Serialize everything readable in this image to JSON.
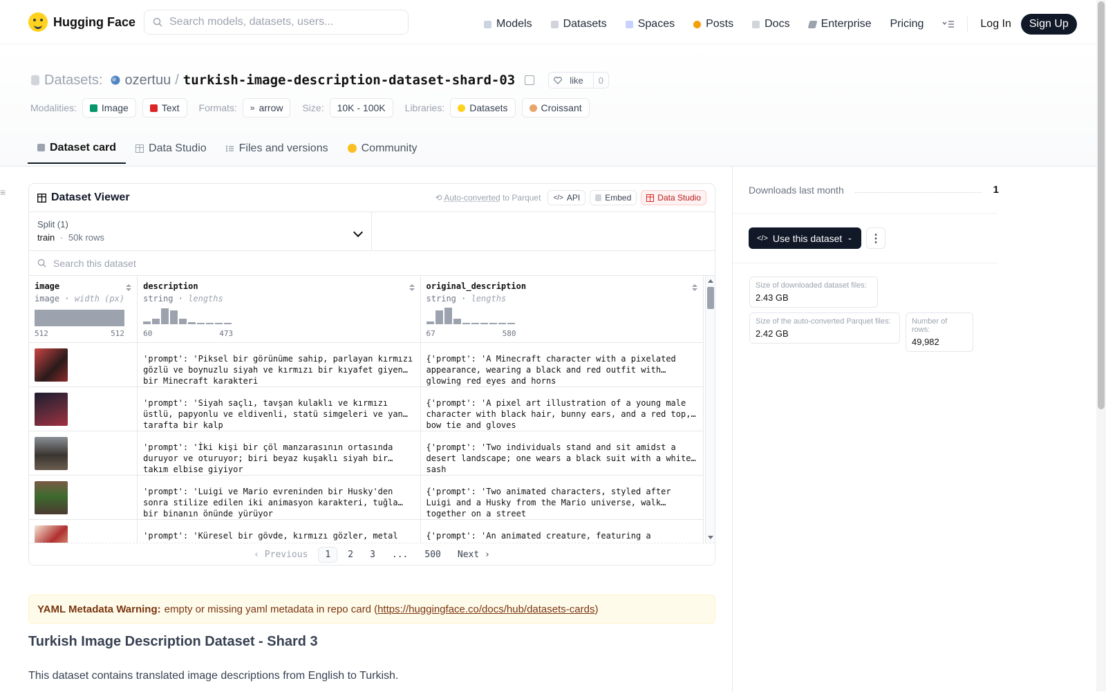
{
  "nav": {
    "brand": "Hugging Face",
    "search_placeholder": "Search models, datasets, users...",
    "links": [
      "Models",
      "Datasets",
      "Spaces",
      "Posts",
      "Docs",
      "Enterprise",
      "Pricing"
    ],
    "login": "Log In",
    "signup": "Sign Up"
  },
  "header": {
    "section_label": "Datasets:",
    "owner": "ozertuu",
    "separator": "/",
    "repo": "turkish-image-description-dataset-shard-03",
    "like_label": "like",
    "like_count": "0",
    "modalities_label": "Modalities:",
    "modalities": [
      "Image",
      "Text"
    ],
    "formats_label": "Formats:",
    "format": "arrow",
    "size_label": "Size:",
    "size": "10K - 100K",
    "libraries_label": "Libraries:",
    "libraries": [
      "Datasets",
      "Croissant"
    ]
  },
  "tabs": [
    "Dataset card",
    "Data Studio",
    "Files and versions",
    "Community"
  ],
  "viewer": {
    "title": "Dataset Viewer",
    "auto_converted": "Auto-converted",
    "to_parquet": "to Parquet",
    "api": "API",
    "embed": "Embed",
    "data_studio": "Data Studio",
    "split_label": "Split (1)",
    "split_name": "train",
    "split_dot": "·",
    "split_rows": "50k rows",
    "search_placeholder": "Search this dataset",
    "columns": [
      {
        "name": "image",
        "type": "image",
        "stat": "width (px)",
        "min": "512",
        "max": "512"
      },
      {
        "name": "description",
        "type": "string",
        "stat": "lengths",
        "min": "60",
        "max": "473"
      },
      {
        "name": "original_description",
        "type": "string",
        "stat": "lengths",
        "min": "67",
        "max": "580"
      }
    ],
    "histograms": {
      "description": [
        0.15,
        0.35,
        0.95,
        0.85,
        0.35,
        0.12,
        0.05,
        0.05,
        0.05,
        0.05
      ],
      "original_description": [
        0.15,
        0.85,
        1.0,
        0.35,
        0.1,
        0.05,
        0.05,
        0.05,
        0.05,
        0.05
      ]
    },
    "rows": [
      {
        "thumb_color": "#8b2a2a",
        "description": "'prompt': 'Piksel bir görünüme sahip, parlayan kırmızı gözlü ve boynuzlu siyah ve kırmızı bir kıyafet giyen bir Minecraft karakteri",
        "original": "{'prompt': 'A Minecraft character with a pixelated appearance, wearing a black and red outfit with glowing red eyes and horns"
      },
      {
        "thumb_color": "#3a2440",
        "description": "'prompt': 'Siyah saçlı, tavşan kulaklı ve kırmızı üstlü, papyonlu ve eldivenli, statü simgeleri ve yan tarafta bir kalp",
        "original": "{'prompt': 'A pixel art illustration of a young male character with black hair, bunny ears, and a red top, bow tie and gloves"
      },
      {
        "thumb_color": "#5b544b",
        "description": "'prompt': 'İki kişi bir çöl manzarasının ortasında duruyor ve oturuyor; biri beyaz kuşaklı siyah bir takım elbise giyiyor",
        "original": "{'prompt': 'Two individuals stand and sit amidst a desert landscape; one wears a black suit with a white sash"
      },
      {
        "thumb_color": "#6b4a3a",
        "description": "'prompt': 'Luigi ve Mario evreninden bir Husky'den sonra stilize edilen iki animasyon karakteri, tuğla bir binanın önünde yürüyor",
        "original": "{'prompt': 'Two animated characters, styled after Luigi and a Husky from the Mario universe, walk together on a street"
      },
      {
        "thumb_color": "#a83c3c",
        "description": "'prompt': 'Küresel bir gövde, kırmızı gözler, metal zırh",
        "original": "{'prompt': 'An animated creature, featuring a spherical body"
      }
    ],
    "pages": {
      "previous": "Previous",
      "items": [
        "1",
        "2",
        "3",
        "...",
        "500"
      ],
      "current": "1",
      "next": "Next"
    }
  },
  "card": {
    "warning_label": "YAML Metadata Warning:",
    "warning_text": "empty or missing yaml metadata in repo card (",
    "warning_link": "https://huggingface.co/docs/hub/datasets-cards",
    "warning_close": ")",
    "heading": "Turkish Image Description Dataset - Shard 3",
    "paragraph": "This dataset contains translated image descriptions from English to Turkish."
  },
  "sidebar": {
    "downloads_label": "Downloads last month",
    "downloads_value": "1",
    "use_button": "Use this dataset",
    "more_button": "⋮",
    "stats": [
      {
        "label": "Size of downloaded dataset files:",
        "value": "2.43 GB"
      },
      {
        "label": "Size of the auto-converted Parquet files:",
        "value": "2.42 GB"
      },
      {
        "label": "Number of rows:",
        "value": "49,982"
      }
    ]
  },
  "colors": {
    "models_icon": "#d1d5db",
    "datasets_icon": "#d1d5db",
    "posts_icon": "#f59e0b",
    "image_tag": "#059669",
    "text_tag": "#dc2626",
    "primary_dark": "#111827",
    "studio_red": "#b91c1c"
  }
}
